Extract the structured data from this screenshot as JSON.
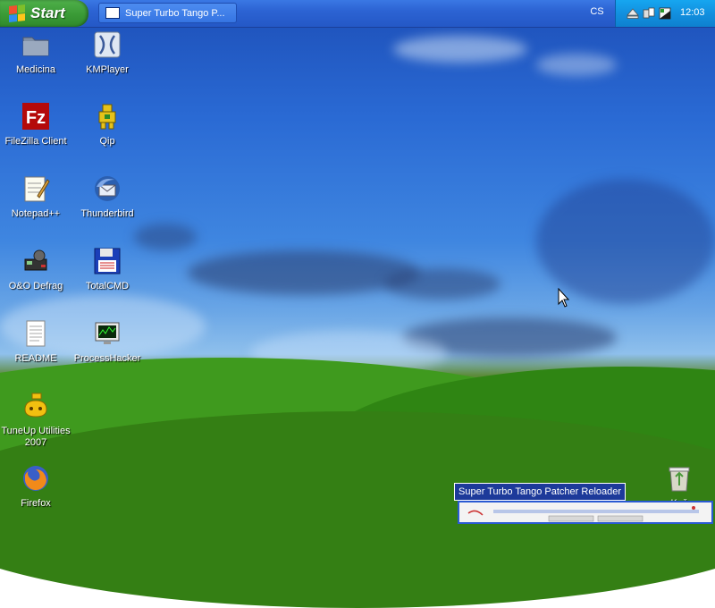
{
  "taskbar": {
    "start_label": "Start",
    "task_title": "Super Turbo Tango P...",
    "language": "CS",
    "clock": "12:03"
  },
  "icons": [
    {
      "label": "Medicina",
      "icon": "folder-icon"
    },
    {
      "label": "KMPlayer",
      "icon": "kmplayer-icon"
    },
    {
      "label": "FileZilla Client",
      "icon": "filezilla-icon"
    },
    {
      "label": "Qip",
      "icon": "qip-icon"
    },
    {
      "label": "Notepad++",
      "icon": "notepad-icon"
    },
    {
      "label": "Thunderbird",
      "icon": "thunderbird-icon"
    },
    {
      "label": "O&O Defrag",
      "icon": "defrag-icon"
    },
    {
      "label": "TotalCMD",
      "icon": "floppy-icon"
    },
    {
      "label": "README",
      "icon": "document-icon"
    },
    {
      "label": "ProcessHacker",
      "icon": "processhacker-icon"
    },
    {
      "label": "TuneUp Utilities 2007",
      "icon": "tuneup-icon"
    },
    {
      "label": "Firefox",
      "icon": "firefox-icon"
    },
    {
      "label": "Koš",
      "icon": "recycle-bin-icon"
    }
  ],
  "popup": {
    "tooltip": "Super Turbo Tango Patcher Reloader"
  },
  "colors": {
    "taskbar": "#2458c6",
    "start": "#3a9a36",
    "tray": "#1290df"
  }
}
